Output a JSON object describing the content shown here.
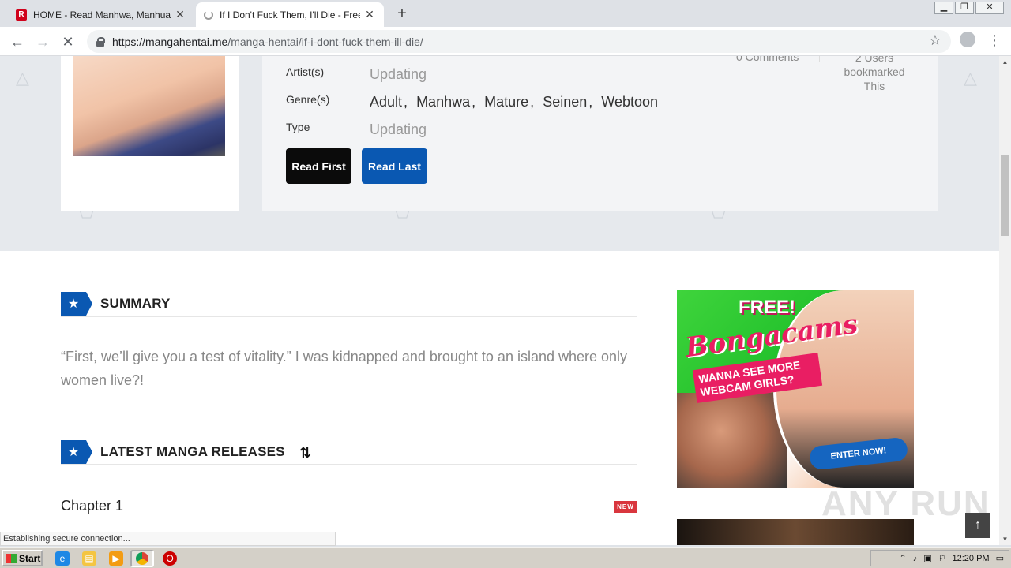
{
  "browser": {
    "tabs": [
      {
        "title": "HOME - Read Manhwa, Manhua, We",
        "active": false
      },
      {
        "title": "If I Don't Fuck Them, I'll Die - Free H",
        "active": true
      }
    ],
    "url_host": "https://mangahentai.me",
    "url_path": "/manga-hentai/if-i-dont-fuck-them-ill-die/",
    "status_text": "Establishing secure connection..."
  },
  "manga": {
    "artist_label": "Artist(s)",
    "artist_value": "Updating",
    "genre_label": "Genre(s)",
    "genres": [
      "Adult",
      "Manhwa",
      "Mature",
      "Seinen",
      "Webtoon"
    ],
    "type_label": "Type",
    "type_value": "Updating",
    "read_first": "Read First",
    "read_last": "Read Last",
    "comments": "0 Comments",
    "bookmarks": "2 Users bookmarked This"
  },
  "summary": {
    "heading": "SUMMARY",
    "text": "“First, we’ll give you a test of vitality.” I was kidnapped and brought to an island where only women live?!"
  },
  "releases": {
    "heading": "LATEST MANGA RELEASES",
    "chapters": [
      {
        "title": "Chapter 1",
        "badge": "NEW"
      }
    ]
  },
  "ad": {
    "free": "FREE!",
    "brand": "Bongacams",
    "tagline": "WANNA SEE MORE WEBCAM GIRLS?",
    "cta": "ENTER NOW!"
  },
  "watermark": "ANY RUN",
  "taskbar": {
    "start": "Start",
    "clock": "12:20 PM"
  },
  "colors": {
    "accent_blue": "#0a58b2",
    "new_badge": "#d9363e"
  }
}
